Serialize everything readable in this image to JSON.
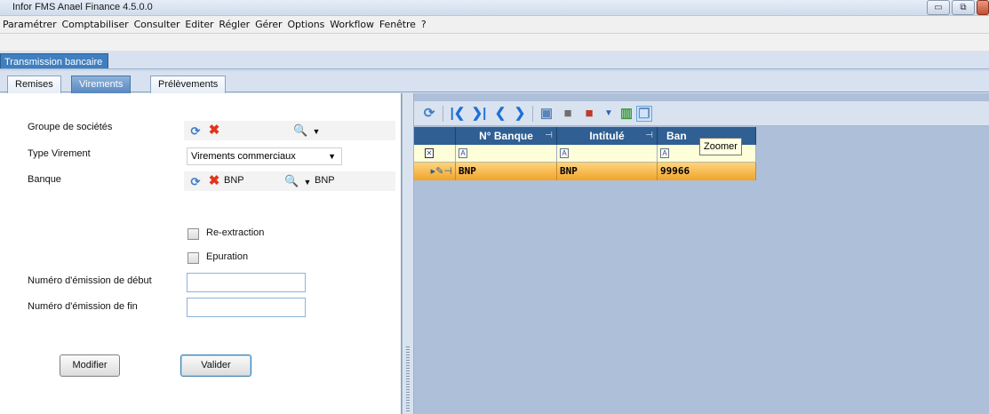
{
  "window": {
    "title": "Infor FMS Anael Finance 4.5.0.0",
    "buttons": [
      "▭",
      "⧉",
      "✕"
    ]
  },
  "menu": [
    "Paramétrer",
    "Comptabiliser",
    "Consulter",
    "Editer",
    "Régler",
    "Gérer",
    "Options",
    "Workflow",
    "Fenêtre",
    "?"
  ],
  "document_tab": "Transmission bancaire",
  "tabs": [
    {
      "label": "Remises",
      "active": false
    },
    {
      "label": "Virements",
      "active": true
    },
    {
      "label": "Prélèvements",
      "active": false
    }
  ],
  "form": {
    "groupe_label": "Groupe de sociétés",
    "type_label": "Type Virement",
    "type_value": "Virements commerciaux",
    "banque_label": "Banque",
    "banque_code": "BNP",
    "banque_name": "BNP",
    "reextraction_label": "Re-extraction",
    "epuration_label": "Epuration",
    "num_debut_label": "Numéro d'émission de début",
    "num_fin_label": "Numéro d'émission de fin",
    "num_debut_value": "",
    "num_fin_value": "",
    "modifier_label": "Modifier",
    "valider_label": "Valider"
  },
  "grid": {
    "columns": [
      "N° Banque",
      "Intitulé",
      "Ban"
    ],
    "rows": [
      [
        "BNP",
        "BNP",
        "99966"
      ]
    ]
  },
  "tooltip": "Zoomer",
  "colors": {
    "header": "#2f5f93",
    "selected_row": "#f4b13c",
    "active_tab": "#5887c0",
    "accent": "#3f7fbf"
  },
  "icons": [
    "refresh-icon",
    "delete-icon",
    "search-icon",
    "first-icon",
    "last-icon",
    "prev-icon",
    "next-icon",
    "export-icon",
    "chart-icon",
    "zoom-icon"
  ]
}
